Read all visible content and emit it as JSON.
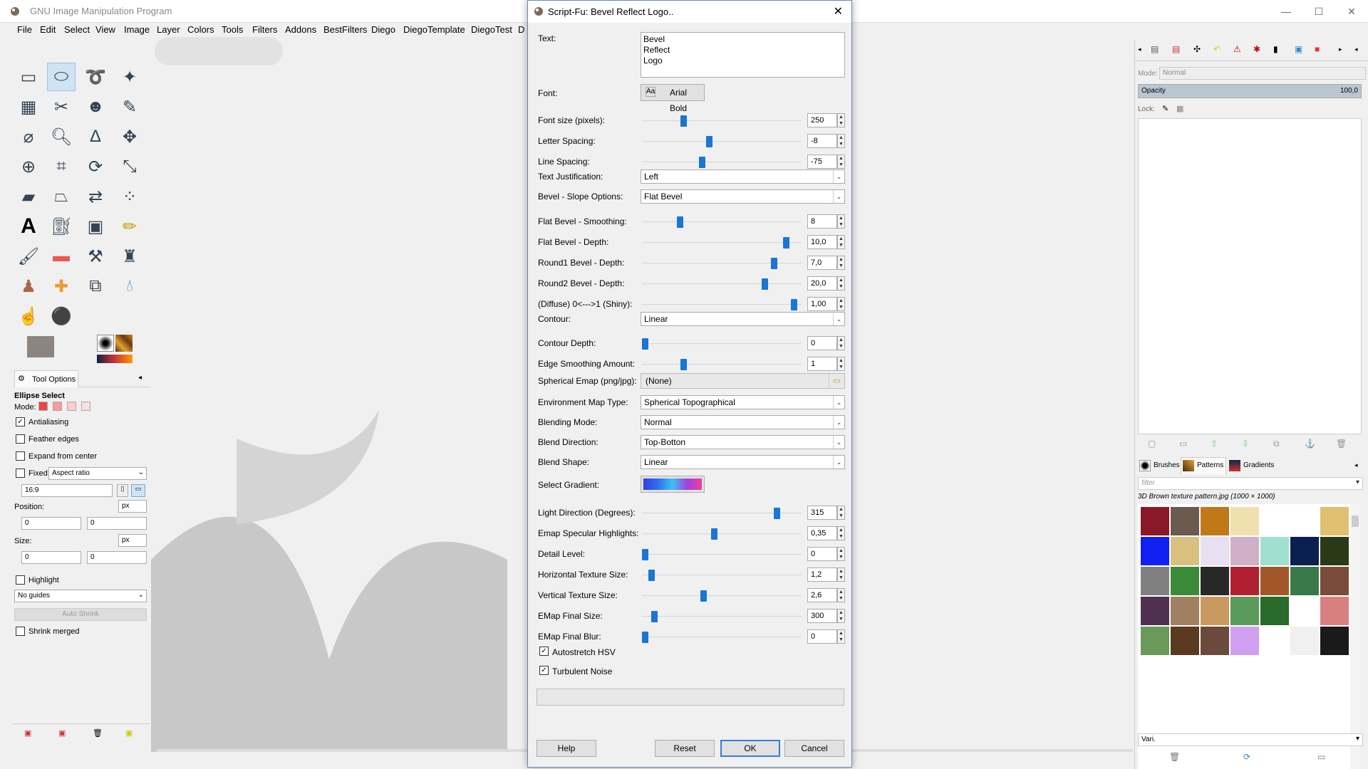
{
  "app": {
    "title": "GNU Image Manipulation Program",
    "win_buttons": [
      "—",
      "☐",
      "✕"
    ]
  },
  "menu": [
    "File",
    "Edit",
    "Select",
    "View",
    "Image",
    "Layer",
    "Colors",
    "Tools",
    "Filters",
    "Addons",
    "BestFilters",
    "Diego",
    "DiegoTemplate",
    "DiegoTest",
    "D"
  ],
  "tool_options": {
    "tab_label": "Tool Options",
    "tool_name": "Ellipse Select",
    "mode_label": "Mode:",
    "antialiasing": "Antialiasing",
    "feather": "Feather edges",
    "expand": "Expand from center",
    "fixed": "Fixed:",
    "fixed_value": "Aspect ratio",
    "ratio": "16:9",
    "position_label": "Position:",
    "size_label": "Size:",
    "unit": "px",
    "pos_x": "0",
    "pos_y": "0",
    "size_w": "0",
    "size_h": "0",
    "highlight": "Highlight",
    "guides": "No guides",
    "auto_shrink": "Auto Shrink",
    "shrink_merged": "Shrink merged"
  },
  "layers": {
    "mode_label": "Mode:",
    "mode_value": "Normal",
    "opacity_label": "Opacity",
    "opacity_value": "100,0",
    "lock_label": "Lock:"
  },
  "patterns": {
    "tabs": [
      "Brushes",
      "Patterns",
      "Gradients"
    ],
    "filter_placeholder": "filter",
    "selected_name": "3D Brown texture pattern.jpg (1000 × 1000)",
    "tag_value": "Vari."
  },
  "dialog": {
    "title": "Script-Fu: Bevel Reflect Logo..",
    "text_label": "Text:",
    "text_lines": [
      "Bevel",
      "Reflect",
      "Logo"
    ],
    "font_label": "Font:",
    "font_value": "Arial Bold",
    "sliders": [
      {
        "label": "Font size (pixels):",
        "value": "250",
        "pos": 0.25
      },
      {
        "label": "Letter Spacing:",
        "value": "-8",
        "pos": 0.42
      },
      {
        "label": "Line Spacing:",
        "value": "-75",
        "pos": 0.37
      },
      {
        "label": "Flat Bevel - Smoothing:",
        "value": "8",
        "pos": 0.23
      },
      {
        "label": "Flat Bevel - Depth:",
        "value": "10,0",
        "pos": 0.92
      },
      {
        "label": "Round1 Bevel - Depth:",
        "value": "7,0",
        "pos": 0.84
      },
      {
        "label": "Round2 Bevel - Depth:",
        "value": "20,0",
        "pos": 0.78
      },
      {
        "label": "(Diffuse) 0<--->1 (Shiny):",
        "value": "1,00",
        "pos": 0.97
      },
      {
        "label": "Contour Depth:",
        "value": "0",
        "pos": 0.0
      },
      {
        "label": "Edge Smoothing Amount:",
        "value": "1",
        "pos": 0.25
      },
      {
        "label": "Light Direction (Degrees):",
        "value": "315",
        "pos": 0.86
      },
      {
        "label": "Emap Specular Highlights:",
        "value": "0,35",
        "pos": 0.45
      },
      {
        "label": "Detail Level:",
        "value": "0",
        "pos": 0.0
      },
      {
        "label": "Horizontal Texture Size:",
        "value": "1,2",
        "pos": 0.04
      },
      {
        "label": "Vertical Texture Size:",
        "value": "2,6",
        "pos": 0.38
      },
      {
        "label": "EMap Final Size:",
        "value": "300",
        "pos": 0.06
      },
      {
        "label": "EMap Final Blur:",
        "value": "0",
        "pos": 0.0
      }
    ],
    "combos": {
      "justification": {
        "label": "Text Justification:",
        "value": "Left"
      },
      "bevel": {
        "label": "Bevel - Slope Options:",
        "value": "Flat Bevel"
      },
      "contour": {
        "label": "Contour:",
        "value": "Linear"
      },
      "envmap": {
        "label": "Environment Map Type:",
        "value": "Spherical Topographical"
      },
      "blending": {
        "label": "Blending Mode:",
        "value": "Normal"
      },
      "direction": {
        "label": "Blend Direction:",
        "value": "Top-Botton"
      },
      "shape": {
        "label": "Blend Shape:",
        "value": "Linear"
      }
    },
    "emap_label": "Spherical Emap (png/jpg):",
    "emap_value": "(None)",
    "gradient_label": "Select Gradient:",
    "autostretch": "Autostretch HSV",
    "turbulent": "Turbulent Noise",
    "buttons": {
      "help": "Help",
      "reset": "Reset",
      "ok": "OK",
      "cancel": "Cancel"
    }
  }
}
